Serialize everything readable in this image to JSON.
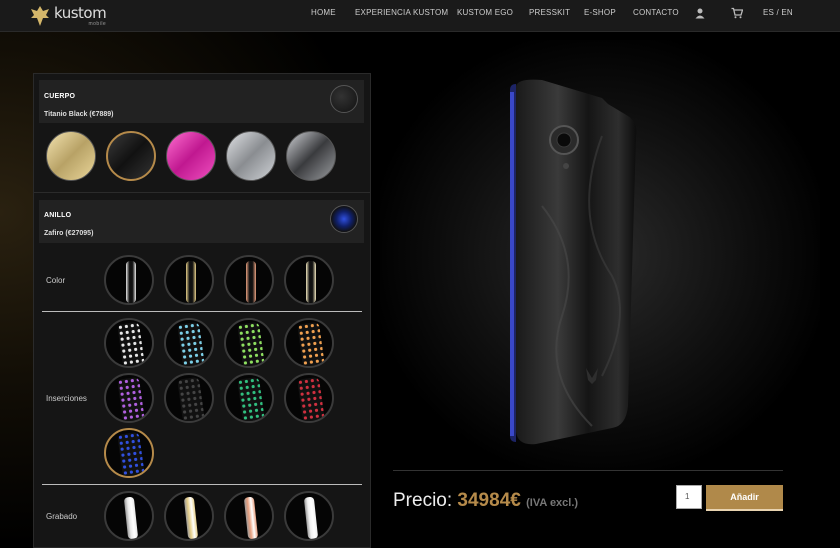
{
  "logo": {
    "word": "kustom",
    "sub": "mobile"
  },
  "nav": {
    "items": [
      "HOME",
      "EXPERIENCIA KUSTOM",
      "KUSTOM EGO",
      "PRESSKIT",
      "E-SHOP",
      "CONTACTO"
    ],
    "lang": "ES / EN",
    "icons": [
      "user-icon",
      "cart-icon"
    ]
  },
  "cuerpo": {
    "title": "CUERPO",
    "selection": "Titanio Black (€7889)",
    "swatches": [
      {
        "name": "gold",
        "color": "#d9c48a"
      },
      {
        "name": "titanio-black",
        "color": "#2a2a2a",
        "selected": true
      },
      {
        "name": "pink",
        "color": "#e040b0"
      },
      {
        "name": "silver",
        "color": "#b5b8bc"
      },
      {
        "name": "dark-silver",
        "color": "#888b8f"
      }
    ]
  },
  "anillo": {
    "title": "ANILLO",
    "selection": "Zafiro (€27095)",
    "color_label": "Color",
    "color_rings": [
      {
        "name": "silver",
        "color": "#e8e8e8"
      },
      {
        "name": "gold",
        "color": "#e6cf8a"
      },
      {
        "name": "rose",
        "color": "#e8a080"
      },
      {
        "name": "champagne",
        "color": "#f1e6bf"
      }
    ],
    "inserts_label": "Inserciones",
    "inserts": [
      {
        "name": "diamond",
        "color": "#e8e8e8"
      },
      {
        "name": "aquamarine",
        "color": "#7ccfe8"
      },
      {
        "name": "peridot",
        "color": "#8ee060"
      },
      {
        "name": "topaz",
        "color": "#f0a050"
      },
      {
        "name": "amethyst",
        "color": "#b060e0"
      },
      {
        "name": "onyx",
        "color": "#444444"
      },
      {
        "name": "emerald",
        "color": "#30c080"
      },
      {
        "name": "ruby",
        "color": "#d03040"
      },
      {
        "name": "zafiro",
        "color": "#3050e0",
        "selected": true
      }
    ],
    "engrave_label": "Grabado",
    "engrave_rings": [
      {
        "name": "silver",
        "color": "#e8e8e8"
      },
      {
        "name": "gold",
        "color": "#e6cf8a"
      },
      {
        "name": "rose",
        "color": "#e8a080"
      },
      {
        "name": "white",
        "color": "#f0f0f0"
      }
    ]
  },
  "price": {
    "label": "Precio:",
    "amount": "34984€",
    "tax": "(IVA excl.)"
  },
  "cart": {
    "quantity": "1",
    "add_label": "Añadir"
  },
  "colors": {
    "accent": "#b58a4a",
    "background": "#000000",
    "panel": "#151515"
  }
}
